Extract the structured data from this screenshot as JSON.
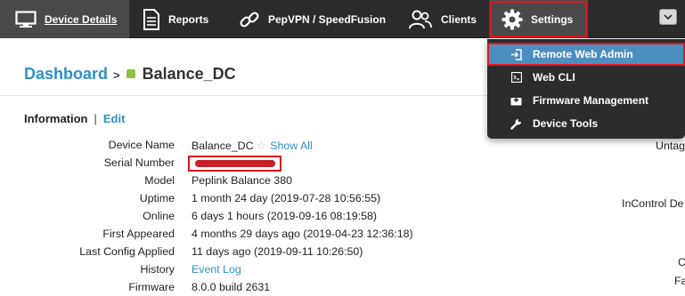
{
  "nav": {
    "items": [
      {
        "label": "Device Details",
        "icon": "monitor-icon",
        "active": true
      },
      {
        "label": "Reports",
        "icon": "document-icon"
      },
      {
        "label": "PepVPN / SpeedFusion",
        "icon": "link-icon"
      },
      {
        "label": "Clients",
        "icon": "users-icon"
      },
      {
        "label": "Settings",
        "icon": "gear-icon",
        "highlighted": true
      }
    ],
    "collapse_icon": "chevron-down-icon"
  },
  "settings_menu": {
    "items": [
      {
        "label": "Remote Web Admin",
        "icon": "login-icon",
        "highlighted": true
      },
      {
        "label": "Web CLI",
        "icon": "terminal-icon"
      },
      {
        "label": "Firmware Management",
        "icon": "download-box-icon"
      },
      {
        "label": "Device Tools",
        "icon": "wrench-icon"
      }
    ]
  },
  "breadcrumb": {
    "root": "Dashboard",
    "separator": ">",
    "device": "Balance_DC",
    "status_color": "#8cc43f"
  },
  "information": {
    "title": "Information",
    "separator": "|",
    "edit_label": "Edit",
    "rows": [
      {
        "label": "Device Name",
        "value": "Balance_DC",
        "link": "Show All"
      },
      {
        "label": "Serial Number",
        "value": "",
        "redacted": true
      },
      {
        "label": "Model",
        "value": "Peplink Balance 380"
      },
      {
        "label": "Uptime",
        "value": "1 month 24 day (2019-07-28 10:56:55)"
      },
      {
        "label": "Online",
        "value": "6 days 1 hours (2019-09-16 08:19:58)"
      },
      {
        "label": "First Appeared",
        "value": "4 months 29 days ago (2019-04-23 12:36:18)"
      },
      {
        "label": "Last Config Applied",
        "value": "11 days ago (2019-09-11 10:26:50)"
      },
      {
        "label": "History",
        "value": "",
        "link": "Event Log"
      },
      {
        "label": "Firmware",
        "value": "8.0.0 build 2631"
      }
    ]
  },
  "right_column_fragments": [
    "Untag",
    "InControl De",
    "C",
    "Fa"
  ],
  "colors": {
    "accent": "#2f8fc6",
    "highlight_outline": "#e3141d",
    "nav_bg": "#2b2b2b",
    "menu_highlight": "#4b8fc0"
  }
}
